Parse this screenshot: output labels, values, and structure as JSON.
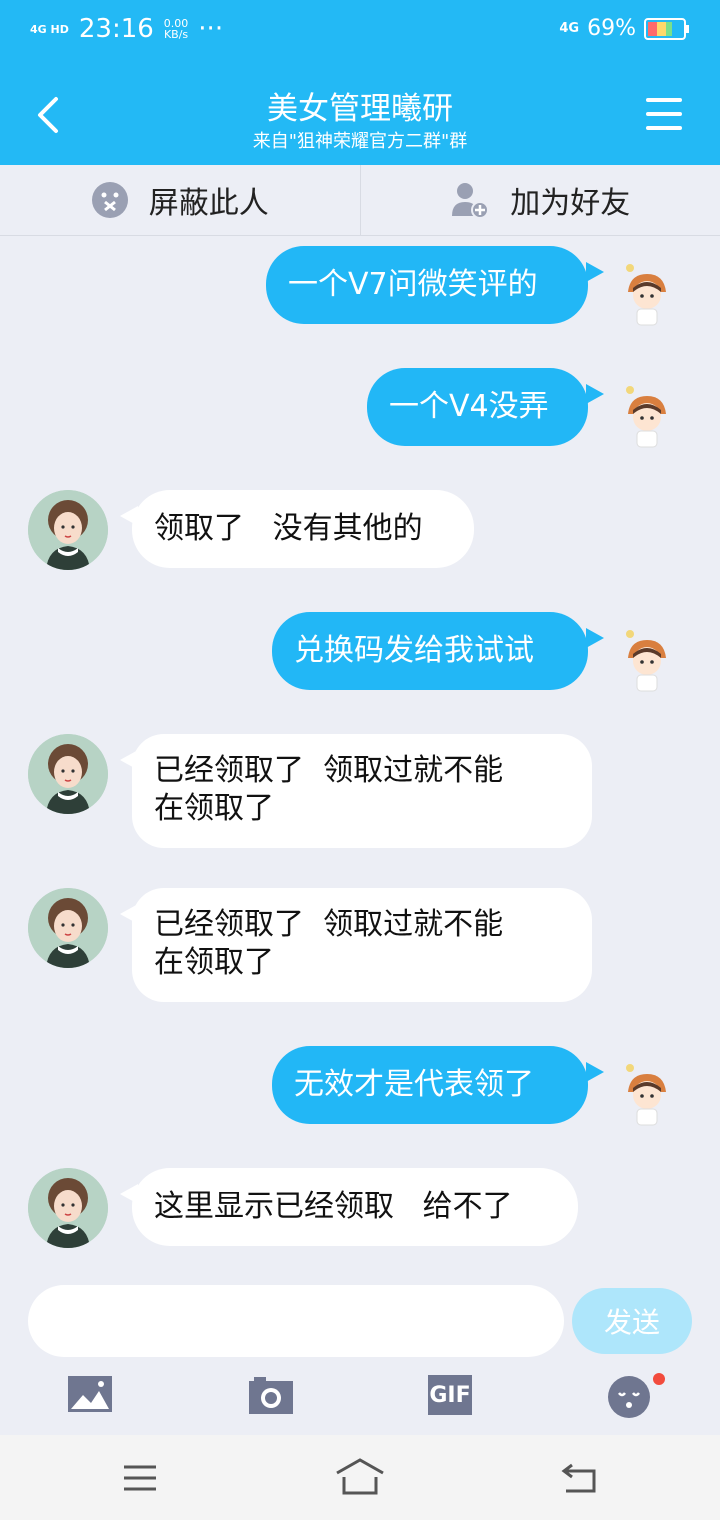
{
  "status_bar": {
    "network": "4G HD",
    "time": "23:16",
    "speed_value": "0.00",
    "speed_unit": "KB/s",
    "more": "···",
    "net_right": "4G",
    "battery": "69%"
  },
  "header": {
    "title": "美女管理曦研",
    "subtitle": "来自\"狙神荣耀官方二群\"群"
  },
  "actions": {
    "block_label": "屏蔽此人",
    "add_friend_label": "加为好友"
  },
  "messages": [
    {
      "side": "me",
      "text": "一个V7问微笑评的"
    },
    {
      "side": "me",
      "text": "一个V4没弄"
    },
    {
      "side": "other",
      "text": "领取了   没有其他的"
    },
    {
      "side": "me",
      "text": "兑换码发给我试试"
    },
    {
      "side": "other",
      "line1": "已经领取了  领取过就不能",
      "line2": "在领取了"
    },
    {
      "side": "other",
      "line1": "已经领取了  领取过就不能",
      "line2": "在领取了"
    },
    {
      "side": "me",
      "text": "无效才是代表领了"
    },
    {
      "side": "other",
      "text": "这里显示已经领取   给不了"
    }
  ],
  "input": {
    "send_label": "发送"
  },
  "toolbar": {
    "gif_label": "GIF"
  },
  "colors": {
    "accent": "#23b9f5",
    "bubble_me": "#22b7f6",
    "background": "#eceef5"
  }
}
